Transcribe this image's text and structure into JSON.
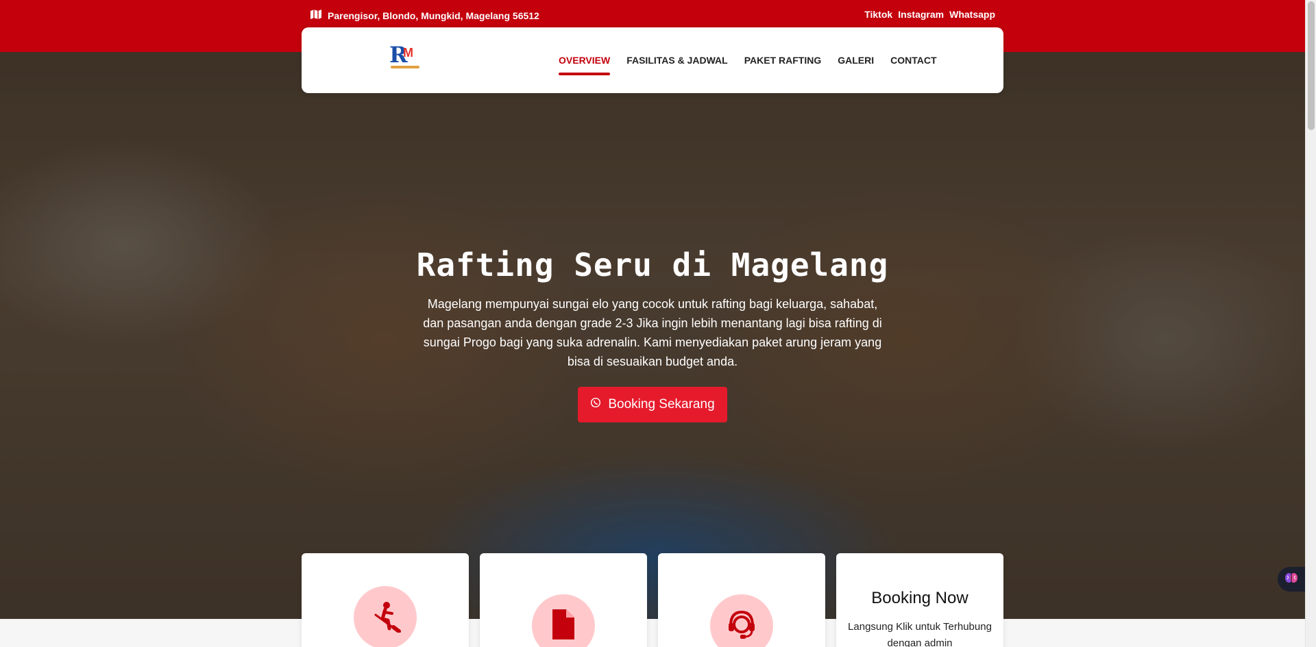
{
  "topbar": {
    "address": "Parengisor, Blondo, Mungkid, Magelang 56512",
    "address_icon": "map-icon",
    "socials": [
      "Tiktok",
      "Instagram",
      "Whatsapp"
    ]
  },
  "nav": {
    "logo_letters": [
      "R",
      "M"
    ],
    "items": [
      "OVERVIEW",
      "FASILITAS & JADWAL",
      "PAKET RAFTING",
      "GALERI",
      "CONTACT"
    ],
    "active": "OVERVIEW"
  },
  "hero": {
    "title": "Rafting Seru di Magelang",
    "description": "Magelang mempunyai sungai elo yang cocok untuk rafting bagi keluarga, sahabat, dan pasangan anda dengan grade 2-3 Jika ingin lebih menantang lagi bisa rafting di sungai Progo bagi yang suka adrenalin. Kami menyediakan paket arung jeram yang bisa di sesuaikan budget anda.",
    "cta_label": "Booking Sekarang",
    "cta_icon": "whatsapp-icon"
  },
  "cards": [
    {
      "icon": "rafting-icon"
    },
    {
      "icon": "document-icon"
    },
    {
      "icon": "headset-support-icon"
    },
    {
      "title": "Booking Now",
      "text": "Langsung Klik untuk Terhubung dengan admin"
    }
  ],
  "colors": {
    "brand_red": "#c3000c",
    "cta_red": "#e51b2c",
    "icon_circle": "#ffc9cc"
  }
}
